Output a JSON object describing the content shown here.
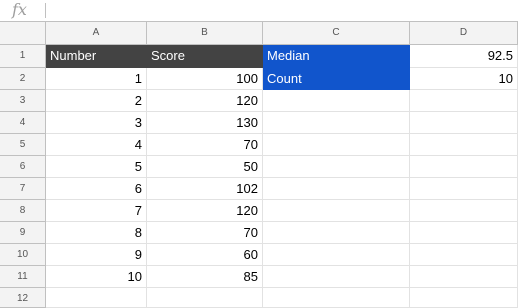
{
  "formula_bar": {
    "icon": "fx",
    "value": ""
  },
  "columns": [
    "A",
    "B",
    "C",
    "D"
  ],
  "rows": [
    "1",
    "2",
    "3",
    "4",
    "5",
    "6",
    "7",
    "8",
    "9",
    "10",
    "11",
    "12"
  ],
  "cells": {
    "A1": "Number",
    "B1": "Score",
    "C1": "Median",
    "D1": "92.5",
    "C2": "Count",
    "D2": "10",
    "A2": "1",
    "B2": "100",
    "A3": "2",
    "B3": "120",
    "A4": "3",
    "B4": "130",
    "A5": "4",
    "B5": "70",
    "A6": "5",
    "B6": "50",
    "A7": "6",
    "B7": "102",
    "A8": "7",
    "B8": "120",
    "A9": "8",
    "B9": "70",
    "A10": "9",
    "B10": "60",
    "A11": "10",
    "B11": "85"
  },
  "colors": {
    "header_fill": "#434343",
    "highlight_fill": "#1155cc",
    "header_text": "#ffffff"
  }
}
